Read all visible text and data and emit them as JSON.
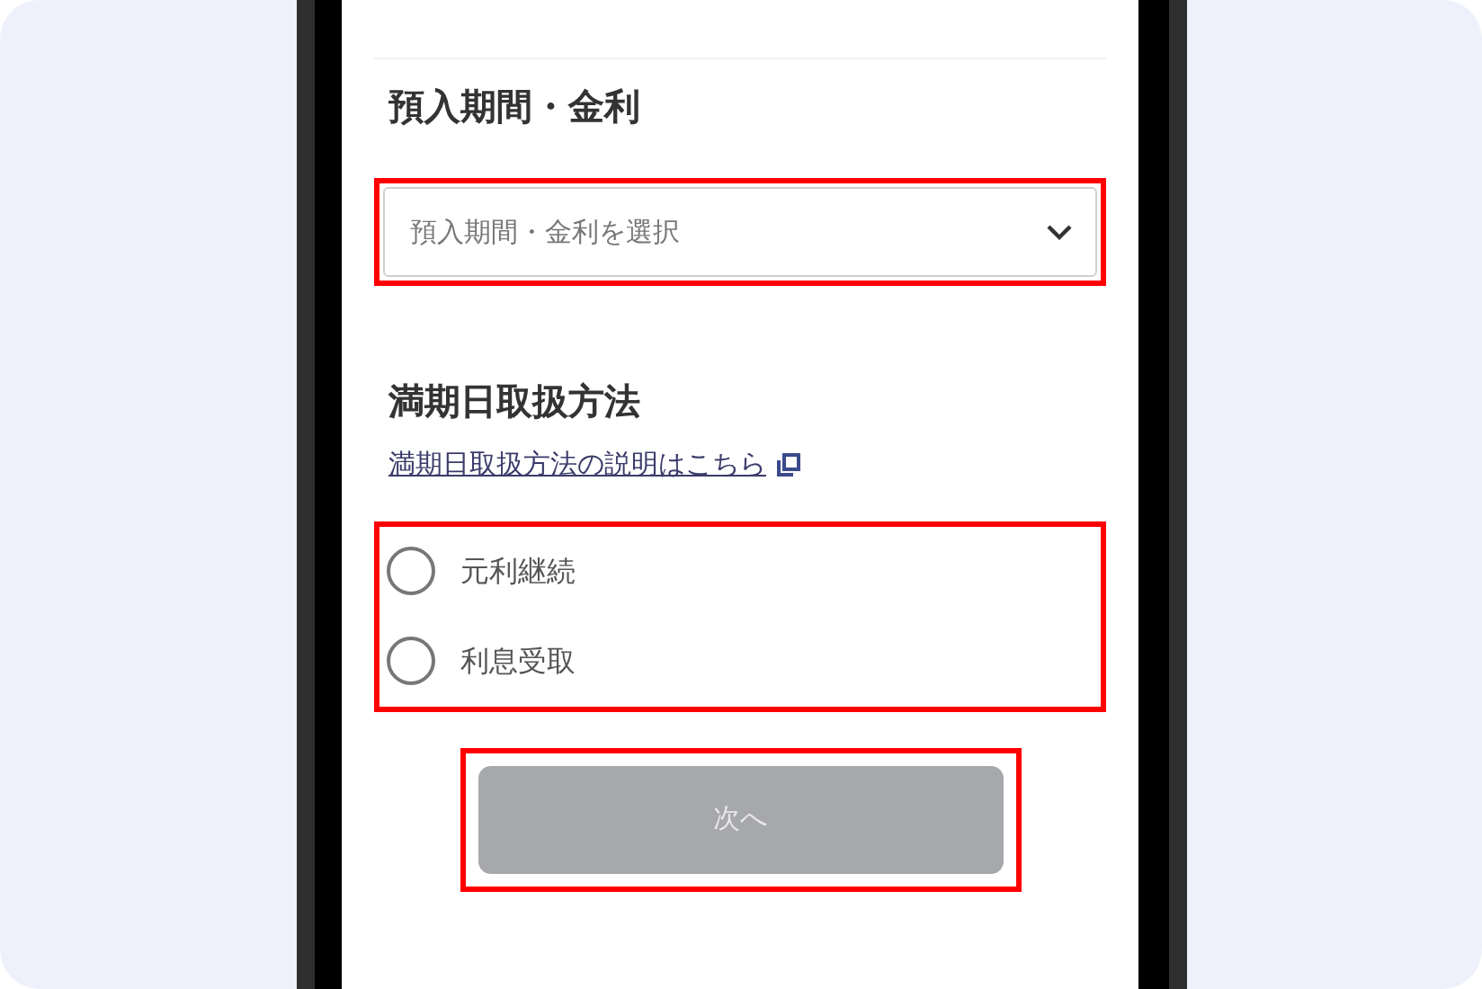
{
  "term_section": {
    "heading": "預入期間・金利",
    "select": {
      "placeholder": "預入期間・金利を選択",
      "highlighted": true
    }
  },
  "maturity_section": {
    "heading": "満期日取扱方法",
    "link": "満期日取扱方法の説明はこちら",
    "highlighted": true,
    "options": [
      {
        "label": "元利継続",
        "selected": false
      },
      {
        "label": "利息受取",
        "selected": false
      }
    ]
  },
  "next_button": {
    "label": "次へ",
    "disabled": true,
    "highlighted": true
  }
}
